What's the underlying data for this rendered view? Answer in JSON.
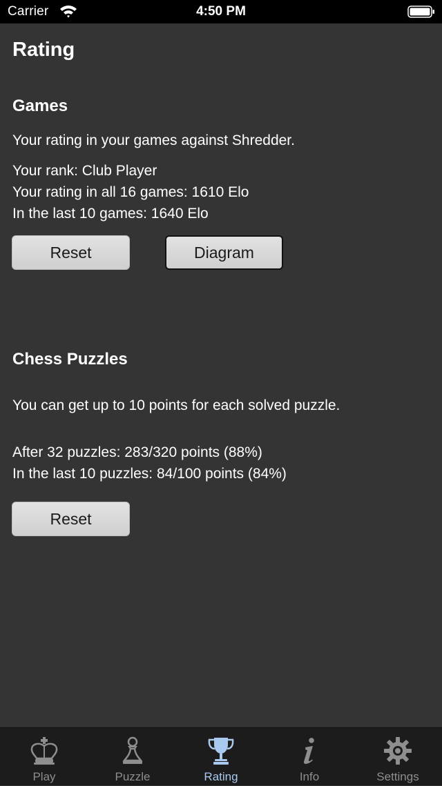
{
  "status_bar": {
    "carrier": "Carrier",
    "time": "4:50 PM"
  },
  "page": {
    "title": "Rating"
  },
  "games": {
    "title": "Games",
    "description": "Your rating in your games against Shredder.",
    "rank": "Your rank: Club Player",
    "rating_all": "Your rating in all 16 games: 1610 Elo",
    "rating_last": "In the last 10 games: 1640 Elo",
    "reset_label": "Reset",
    "diagram_label": "Diagram"
  },
  "puzzles": {
    "title": "Chess Puzzles",
    "description": "You can get up to 10 points for each solved puzzle.",
    "after": "After 32 puzzles: 283/320 points (88%)",
    "last": "In the last 10 puzzles: 84/100 points (84%)",
    "reset_label": "Reset"
  },
  "tab_bar": {
    "active_color": "#a9c9ee",
    "inactive_color": "#8e8e8e",
    "tabs": [
      {
        "label": "Play",
        "icon": "king-icon"
      },
      {
        "label": "Puzzle",
        "icon": "pawn-icon"
      },
      {
        "label": "Rating",
        "icon": "trophy-icon",
        "active": true
      },
      {
        "label": "Info",
        "icon": "info-icon"
      },
      {
        "label": "Settings",
        "icon": "gear-icon"
      }
    ]
  }
}
